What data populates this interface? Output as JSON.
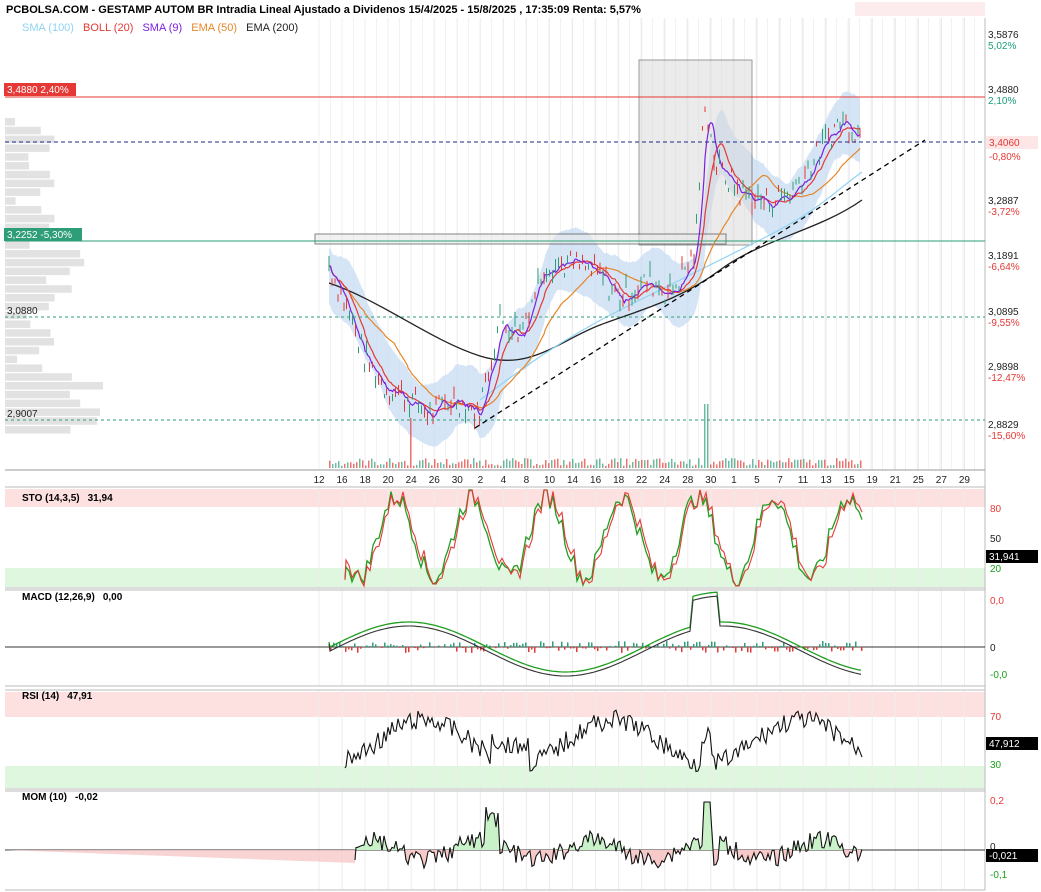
{
  "header": {
    "title": "PCBOLSA.COM - GESTAMP AUTOM BR Intradia Lineal Ajustado a Dividenos 15/4/2025 - 15/8/2025 , 17:35:09 Renta: 5,57%"
  },
  "legend": [
    {
      "label": "SMA (100)",
      "color": "#8fd3f4"
    },
    {
      "label": "BOLL (20)",
      "color": "#e53935"
    },
    {
      "label": "SMA (9)",
      "color": "#7b1fe0"
    },
    {
      "label": "EMA (50)",
      "color": "#e6862a"
    },
    {
      "label": "EMA (200)",
      "color": "#222222"
    }
  ],
  "price_axis": [
    {
      "price": "3,5876",
      "pct": "5,02%",
      "pct_color": "#1a9e7e"
    },
    {
      "price": "3,4880",
      "pct": "2,10%",
      "pct_color": "#1a9e7e"
    },
    {
      "price": "3,2887",
      "pct": "-3,72%",
      "pct_color": "#e53935"
    },
    {
      "price": "3,1891",
      "pct": "-6,64%",
      "pct_color": "#e53935"
    },
    {
      "price": "3,0895",
      "pct": "-9,55%",
      "pct_color": "#e53935"
    },
    {
      "price": "2,9898",
      "pct": "-12,47%",
      "pct_color": "#e53935"
    },
    {
      "price": "2,8829",
      "pct": "-15,60%",
      "pct_color": "#e53935"
    }
  ],
  "current_price": {
    "value": "3,4060",
    "pct": "-0,80%"
  },
  "level_labels": {
    "top_red": "3,4880  2,40%",
    "green": "3,2252  -5,30%",
    "dotted_upper": "3,0880",
    "dotted_lower": "2,9007"
  },
  "colors": {
    "green": "#2e9e78",
    "red": "#e53935",
    "band": "#c7dcf3",
    "sma100": "#8fd3f4",
    "boll": "#e53935",
    "sma9": "#7b1fe0",
    "ema50": "#e6862a",
    "ema200": "#222222"
  },
  "x_axis_ticks": [
    "12",
    "16",
    "18",
    "20",
    "24",
    "26",
    "30",
    "2",
    "4",
    "8",
    "10",
    "14",
    "16",
    "18",
    "22",
    "24",
    "28",
    "30",
    "1",
    "5",
    "7",
    "11",
    "13",
    "15",
    "19",
    "21",
    "25",
    "27",
    "29"
  ],
  "panels": {
    "sto": {
      "label": "STO (14,3,5)",
      "value": "31,94",
      "current": "31,941",
      "levels": [
        "80",
        "50",
        "20"
      ]
    },
    "macd": {
      "label": "MACD (12,26,9)",
      "value": "0,00",
      "levels": [
        "0,0",
        "0",
        "-0,0"
      ]
    },
    "rsi": {
      "label": "RSI (14)",
      "value": "47,91",
      "current": "47,912",
      "levels": [
        "70",
        "30"
      ]
    },
    "mom": {
      "label": "MOM (10)",
      "value": "-0,02",
      "current": "-0,021",
      "levels": [
        "0,2",
        "0",
        "-0,1"
      ]
    }
  },
  "chart_data": {
    "type": "line",
    "x_ticks": [
      "12",
      "16",
      "18",
      "20",
      "24",
      "26",
      "30",
      "2",
      "4",
      "8",
      "10",
      "14",
      "16",
      "18",
      "22",
      "24",
      "28",
      "30",
      "1",
      "5",
      "7",
      "11",
      "13",
      "15",
      "19",
      "21",
      "25",
      "27",
      "29"
    ],
    "price_series": [
      {
        "x": "12",
        "y": 3.16
      },
      {
        "x": "16",
        "y": 3.1
      },
      {
        "x": "18",
        "y": 3.02
      },
      {
        "x": "20",
        "y": 2.95
      },
      {
        "x": "24",
        "y": 2.93
      },
      {
        "x": "26",
        "y": 2.9
      },
      {
        "x": "30",
        "y": 2.92
      },
      {
        "x": "2",
        "y": 2.9
      },
      {
        "x": "4",
        "y": 3.08
      },
      {
        "x": "8",
        "y": 3.06
      },
      {
        "x": "10",
        "y": 3.17
      },
      {
        "x": "14",
        "y": 3.17
      },
      {
        "x": "16",
        "y": 3.15
      },
      {
        "x": "18",
        "y": 3.11
      },
      {
        "x": "22",
        "y": 3.14
      },
      {
        "x": "24",
        "y": 3.12
      },
      {
        "x": "28",
        "y": 3.18
      },
      {
        "x": "30",
        "y": 3.47
      },
      {
        "x": "1",
        "y": 3.33
      },
      {
        "x": "5",
        "y": 3.3
      },
      {
        "x": "7",
        "y": 3.28
      },
      {
        "x": "11",
        "y": 3.32
      },
      {
        "x": "13",
        "y": 3.4
      },
      {
        "x": "15",
        "y": 3.42
      },
      {
        "x": "15",
        "y": 3.406
      }
    ]
  }
}
